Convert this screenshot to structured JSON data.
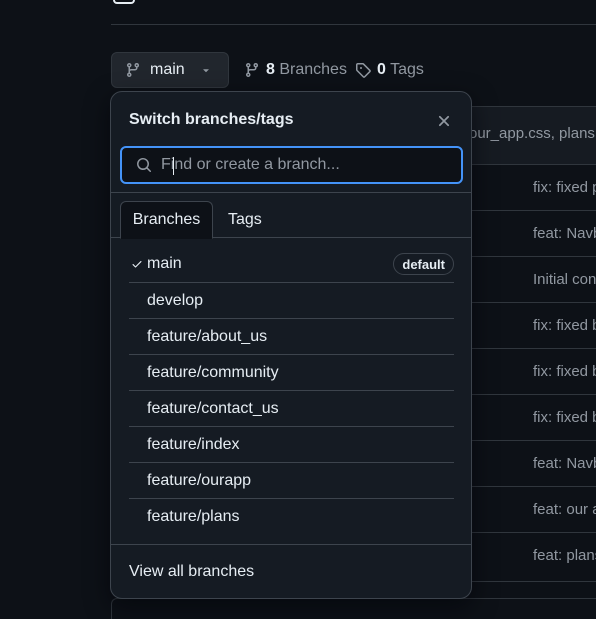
{
  "branch_button": {
    "label": "main",
    "icon": "git-branch-icon",
    "caret_icon": "triangle-down-icon"
  },
  "stats": {
    "branches_count": "8",
    "branches_label": "Branches",
    "tags_count": "0",
    "tags_label": "Tags"
  },
  "background": {
    "header_text": "our_app.css, plans",
    "commit_messages": [
      "fix: fixed p",
      "feat: Navb",
      "Initial con",
      "fix: fixed b",
      "fix: fixed b",
      "fix: fixed b",
      "feat: Navb",
      "feat: our a",
      "feat: plans"
    ]
  },
  "dropdown": {
    "title": "Switch branches/tags",
    "search_placeholder": "Find or create a branch...",
    "tabs": [
      {
        "label": "Branches",
        "active": true
      },
      {
        "label": "Tags",
        "active": false
      }
    ],
    "branches": [
      {
        "name": "main",
        "selected": true,
        "badge": "default"
      },
      {
        "name": "develop"
      },
      {
        "name": "feature/about_us"
      },
      {
        "name": "feature/community"
      },
      {
        "name": "feature/contact_us"
      },
      {
        "name": "feature/index"
      },
      {
        "name": "feature/ourapp"
      },
      {
        "name": "feature/plans"
      }
    ],
    "footer_link": "View all branches"
  },
  "colors": {
    "background": "#0d1117",
    "panel": "#151b23",
    "border": "#3d444d",
    "accent": "#4493f8",
    "text": "#e6edf3",
    "muted": "#9198a1"
  }
}
